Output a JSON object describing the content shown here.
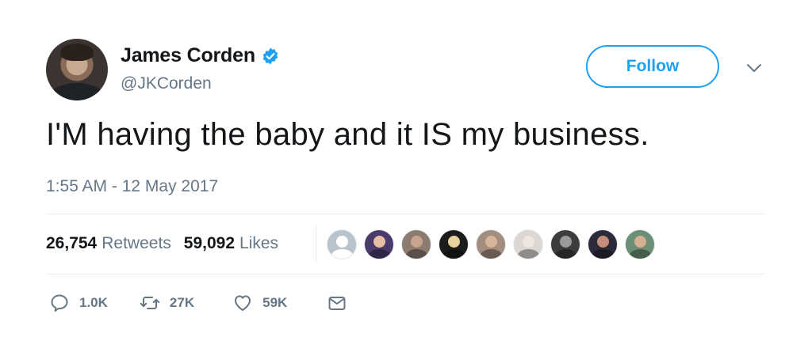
{
  "user": {
    "name": "James Corden",
    "handle": "@JKCorden",
    "verified": true
  },
  "follow_button": {
    "label": "Follow"
  },
  "tweet": {
    "text": "I'M having the baby and it IS my business.",
    "timestamp": "1:55 AM - 12 May 2017"
  },
  "stats": {
    "retweets": {
      "count": "26,754",
      "label": "Retweets"
    },
    "likes": {
      "count": "59,092",
      "label": "Likes"
    }
  },
  "likers": [
    {
      "icon": "default-avatar",
      "head": "#ffffff",
      "bg": "#b8c3cc"
    },
    {
      "icon": "avatar-man",
      "head": "#e6bfa6",
      "bg": "#4a3b6b"
    },
    {
      "icon": "avatar-woman",
      "head": "#c9a48c",
      "bg": "#8c7c70"
    },
    {
      "icon": "avatar-blonde",
      "head": "#e8d3a0",
      "bg": "#1c1c1c"
    },
    {
      "icon": "avatar-couple",
      "head": "#d8b59a",
      "bg": "#a38d7e"
    },
    {
      "icon": "avatar-woman-light",
      "head": "#f0e6e0",
      "bg": "#dcd7d3"
    },
    {
      "icon": "avatar-bw",
      "head": "#9a9a9a",
      "bg": "#3c3c3c"
    },
    {
      "icon": "avatar-group",
      "head": "#c48f7a",
      "bg": "#2b2a3a"
    },
    {
      "icon": "avatar-pair",
      "head": "#d6b093",
      "bg": "#6b8e74"
    }
  ],
  "actions": {
    "reply": {
      "icon": "reply-icon",
      "count": "1.0K"
    },
    "retweet": {
      "icon": "retweet-icon",
      "count": "27K"
    },
    "like": {
      "icon": "heart-icon",
      "count": "59K"
    },
    "message": {
      "icon": "mail-icon"
    }
  },
  "colors": {
    "accent": "#1da1f2",
    "text": "#14171a",
    "muted": "#657786",
    "divider": "#e6ecf0"
  }
}
